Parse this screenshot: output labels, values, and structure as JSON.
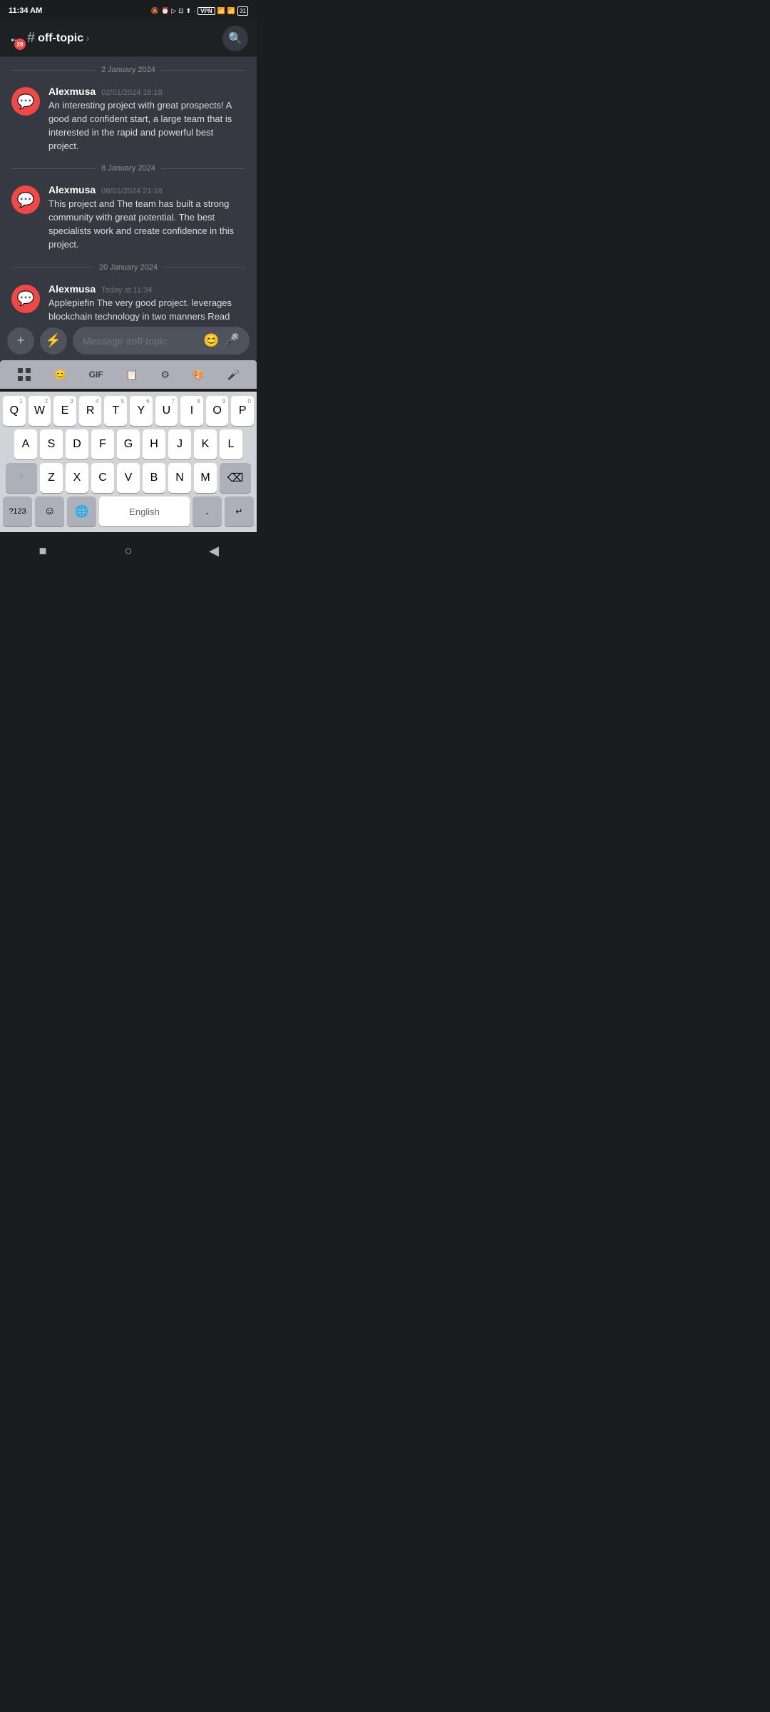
{
  "statusBar": {
    "time": "11:34 AM",
    "vpn": "VPN",
    "battery": "31"
  },
  "header": {
    "back_badge": "29",
    "hash": "#",
    "channel_name": "off-topic",
    "chevron": "›",
    "search_icon": "🔍"
  },
  "dates": {
    "date1": "2 January 2024",
    "date2": "8 January 2024",
    "date3": "20 January 2024"
  },
  "messages": [
    {
      "username": "Alexmusa",
      "timestamp": "02/01/2024 16:18",
      "text": "An interesting project with great prospects! A good and confident start, a large team that is interested in the rapid and powerful best project."
    },
    {
      "username": "Alexmusa",
      "timestamp": "08/01/2024 21:18",
      "text": "This project and The team has built a strong community with great potential. The best specialists work and create confidence in this project."
    },
    {
      "username": "Alexmusa",
      "timestamp": "Today at 11:34",
      "text": "Applepiefin The very good project. leverages blockchain technology in two manners Read more WP. It is very interesting to observe the development this project."
    }
  ],
  "inputBar": {
    "plus_icon": "+",
    "bolt_icon": "⚡",
    "placeholder": "Message #off-topic",
    "emoji_icon": "😊",
    "mic_icon": "🎤"
  },
  "keyboard": {
    "toolbar_items": [
      "⊞",
      "😊",
      "GIF",
      "📋",
      "⚙",
      "🎨",
      "🎤"
    ],
    "row1": [
      "Q",
      "W",
      "E",
      "R",
      "T",
      "Y",
      "U",
      "I",
      "O",
      "P"
    ],
    "row1_nums": [
      "1",
      "2",
      "3",
      "4",
      "5",
      "6",
      "7",
      "8",
      "9",
      "0"
    ],
    "row2": [
      "A",
      "S",
      "D",
      "F",
      "G",
      "H",
      "J",
      "K",
      "L"
    ],
    "row3": [
      "Z",
      "X",
      "C",
      "V",
      "B",
      "N",
      "M"
    ],
    "special_left": "?123",
    "comma_icon": "☺",
    "globe_icon": "🌐",
    "space_label": "English",
    "period": ".",
    "enter_icon": "↵",
    "backspace_icon": "⌫",
    "shift_icon": "↑"
  },
  "navBar": {
    "square_icon": "■",
    "circle_icon": "○",
    "back_icon": "◀"
  }
}
